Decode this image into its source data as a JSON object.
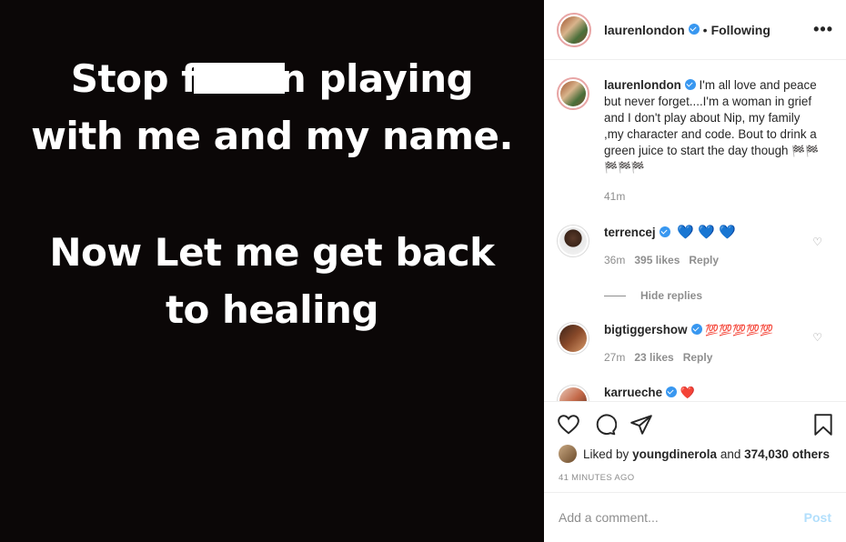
{
  "media": {
    "line1_a": "Stop f",
    "line1_b": "n playing",
    "line2": "with me and my name.",
    "line3": "Now Let me get back",
    "line4": "to healing"
  },
  "header": {
    "username": "laurenlondon",
    "separator": "•",
    "following": "Following",
    "more": "•••"
  },
  "caption": {
    "username": "laurenlondon",
    "text": "I'm all love and peace but never forget....I'm a woman in grief and I don't play about Nip, my family ,my character and code. Bout to drink a green juice to start the day though",
    "flags": "🏁🏁🏁🏁🏁",
    "time": "41m"
  },
  "comments": [
    {
      "username": "terrencej",
      "emoji": "💙 💙 💙",
      "time": "36m",
      "likes": "395 likes",
      "reply": "Reply"
    },
    {
      "username": "bigtiggershow",
      "emoji": "💯💯💯💯💯",
      "time": "27m",
      "likes": "23 likes",
      "reply": "Reply"
    },
    {
      "username": "karrueche",
      "emoji": "❤️"
    }
  ],
  "hide_replies": "Hide replies",
  "likes": {
    "prefix": "Liked by",
    "user": "youngdinerola",
    "and": "and",
    "count": "374,030 others"
  },
  "time_ago": "41 MINUTES AGO",
  "comment_box": {
    "placeholder": "Add a comment...",
    "post": "Post"
  },
  "colors": {
    "verified": "#3897f0",
    "post_disabled": "#b2dffc",
    "muted": "#8e8e8e"
  }
}
